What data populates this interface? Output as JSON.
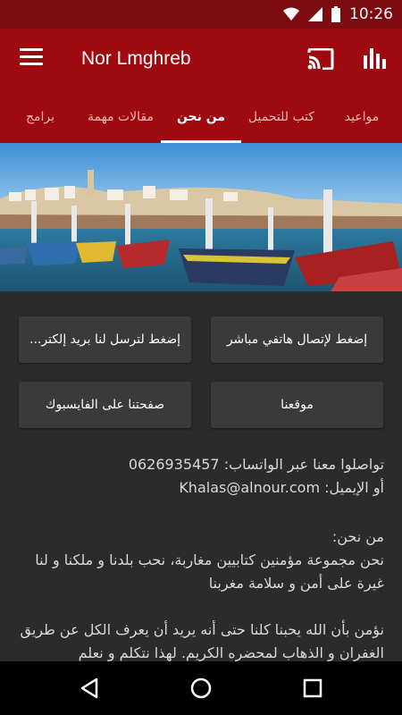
{
  "status_bar": {
    "time": "10:26"
  },
  "app_bar": {
    "title": "Nor Lmghreb"
  },
  "tabs": [
    {
      "label": "مواعيد"
    },
    {
      "label": "كتب للتحميل"
    },
    {
      "label": "من نحن"
    },
    {
      "label": "مقالات مهمة"
    },
    {
      "label": "برامج"
    }
  ],
  "buttons": {
    "call": "إضغط لإتصال هاتفي مباشر",
    "email": "إضغط لترسل لنا بريد إلكتر...",
    "website": "موقعنا",
    "facebook": "صفحتنا على الفايسبوك"
  },
  "contact": {
    "whatsapp_label": "تواصلوا معنا عبر الواتساب:",
    "whatsapp_number": "0626935457",
    "email_label": "أو الإيميل:",
    "email_value": "Khalas@alnour.com"
  },
  "about": {
    "heading": "من نحن:",
    "paragraph1": "نحن مجموعة مؤمنين كتابيين مغاربة، نحب بلدنا و ملكنا و لنا غيرة على أمن و سلامة مغربنا",
    "paragraph2": "نؤمن بأن الله يحبنا كلنا حتى أنه يريد أن يعرف الكل عن طريق الغفران و الذهاب لمحضره الكريم. لهذا نتكلم و نعلم"
  },
  "colors": {
    "primary": "#9e0a10",
    "primary_dark": "#7d0a0f",
    "background": "#2b2b2b",
    "button": "#3a3a3a"
  }
}
